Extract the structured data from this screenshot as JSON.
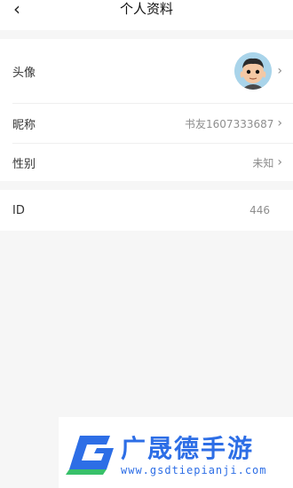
{
  "header": {
    "title": "个人资料",
    "back_icon": "chevron-left-icon"
  },
  "profile": {
    "avatar_label": "头像",
    "nickname_label": "昵称",
    "nickname_value": "书友1607333687",
    "gender_label": "性别",
    "gender_value": "未知"
  },
  "account": {
    "id_label": "ID",
    "id_value": "446"
  },
  "watermark": {
    "brand": "广晟德手游",
    "url": "www.gsdtiepianji.com"
  }
}
